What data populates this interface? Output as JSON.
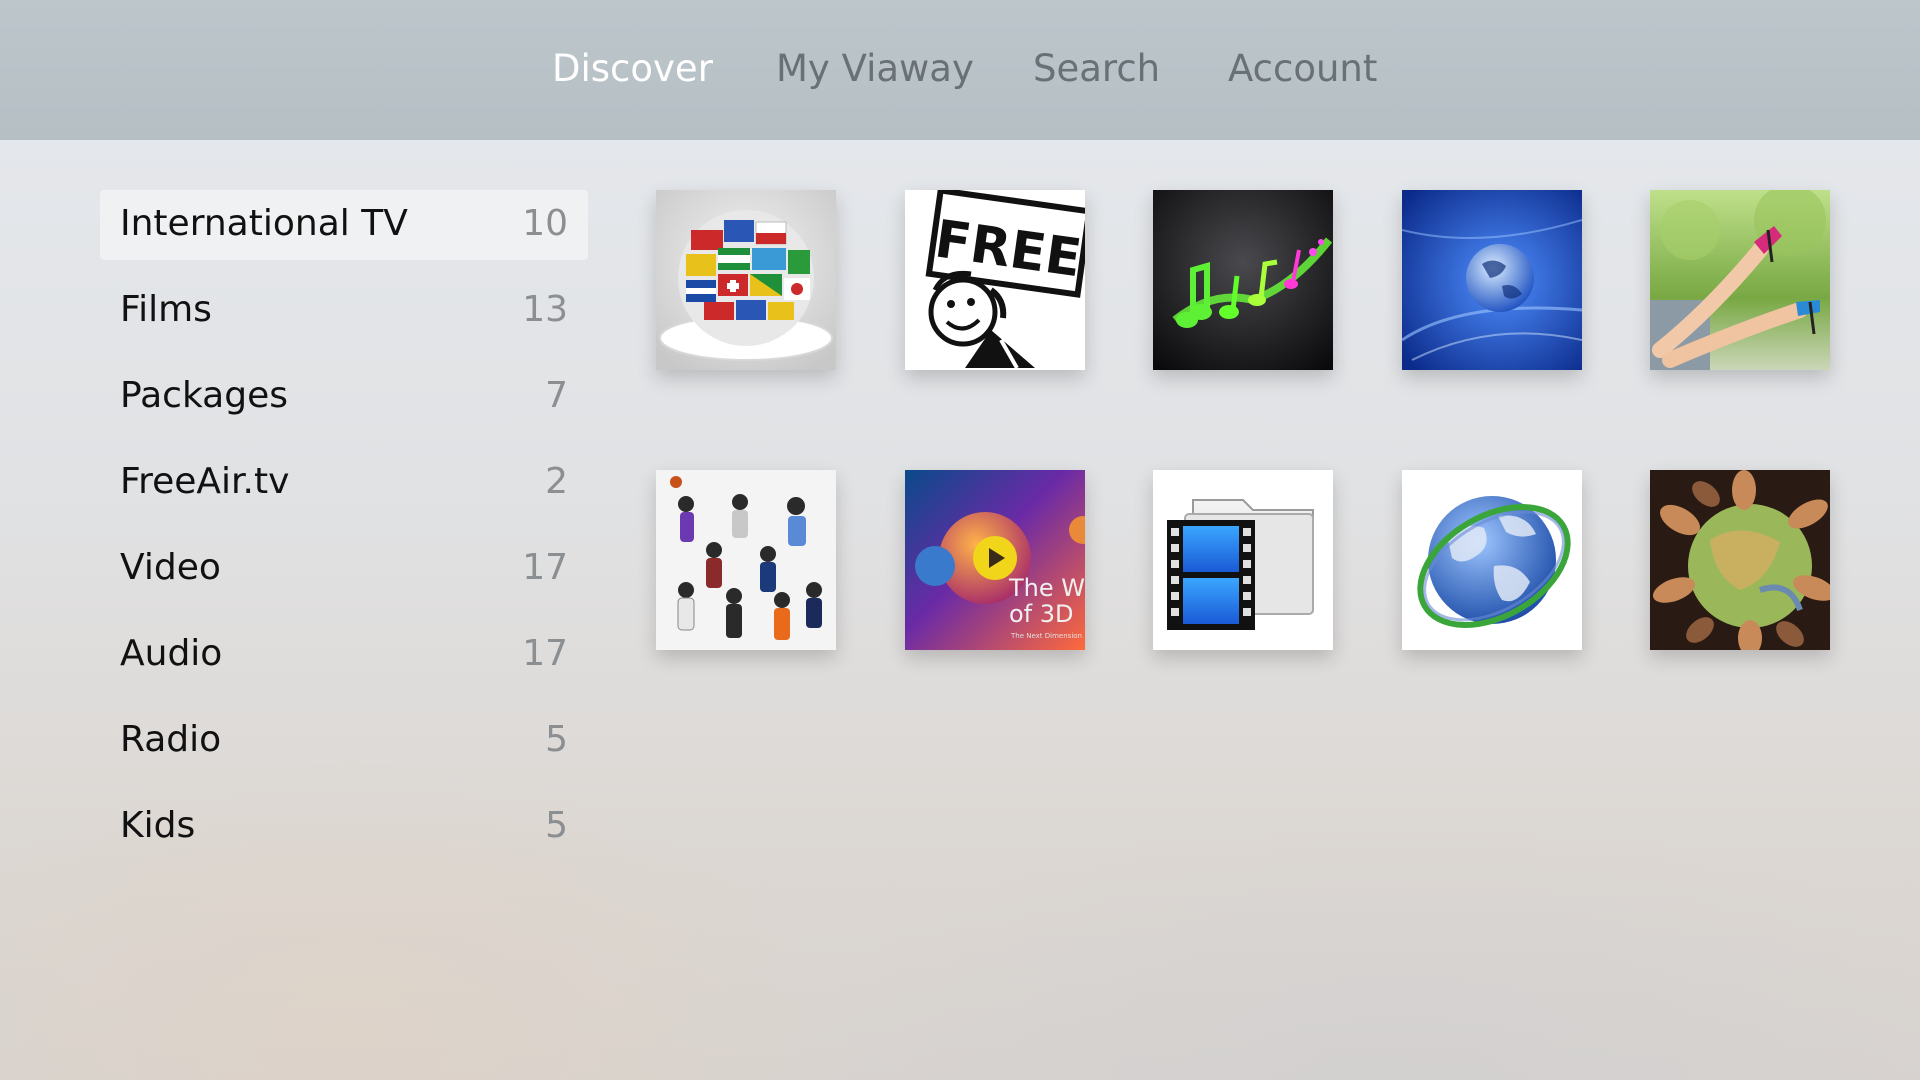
{
  "nav": {
    "tabs": [
      {
        "label": "Discover",
        "active": true
      },
      {
        "label": "My Viaway",
        "active": false
      },
      {
        "label": "Search",
        "active": false
      },
      {
        "label": "Account",
        "active": false
      }
    ]
  },
  "sidebar": {
    "items": [
      {
        "label": "International TV",
        "count": "10",
        "selected": true
      },
      {
        "label": "Films",
        "count": "13"
      },
      {
        "label": "Packages",
        "count": "7"
      },
      {
        "label": "FreeAir.tv",
        "count": "2"
      },
      {
        "label": "Video",
        "count": "17"
      },
      {
        "label": "Audio",
        "count": "17"
      },
      {
        "label": "Radio",
        "count": "5"
      },
      {
        "label": "Kids",
        "count": "5"
      }
    ]
  },
  "grid": {
    "tiles": [
      {
        "icon": "flag-globe-icon"
      },
      {
        "icon": "free-sign-icon",
        "text": "FREE"
      },
      {
        "icon": "music-notes-icon"
      },
      {
        "icon": "digital-globe-icon"
      },
      {
        "icon": "high-heels-icon"
      },
      {
        "icon": "sports-collage-icon"
      },
      {
        "icon": "3d-video-icon",
        "text_line1": "The W",
        "text_line2": "of 3D",
        "text_small": "The Next Dimension"
      },
      {
        "icon": "film-folder-icon"
      },
      {
        "icon": "earth-globe-icon"
      },
      {
        "icon": "hands-on-globe-icon"
      }
    ]
  },
  "colors": {
    "topbar": "#b9c3c8",
    "active_tab": "#ffffff",
    "inactive_tab": "#6a7176",
    "sidebar_text": "#111111",
    "sidebar_count": "#8c8f92",
    "play_button": "#f1d51a"
  }
}
